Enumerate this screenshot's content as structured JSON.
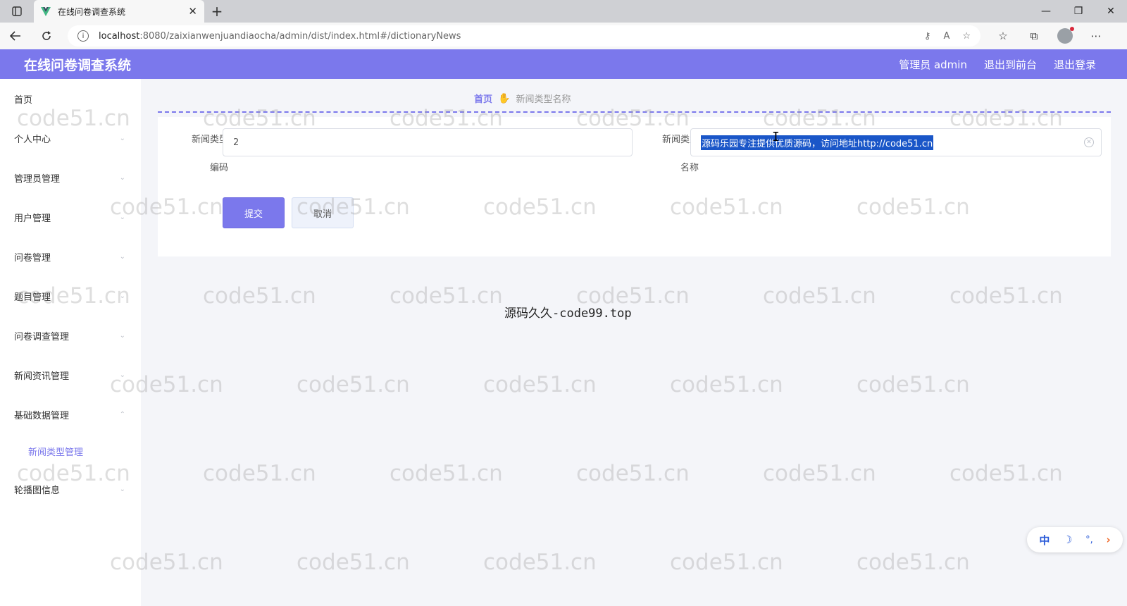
{
  "browser": {
    "tab_title": "在线问卷调查系统",
    "url_host": "localhost",
    "url_path": ":8080/zaixianwenjuandiaocha/admin/dist/index.html#/dictionaryNews"
  },
  "header": {
    "title": "在线问卷调查系统",
    "admin_label": "管理员 admin",
    "to_front_label": "退出到前台",
    "logout_label": "退出登录",
    "accent": "#7b78ec"
  },
  "sidebar": {
    "items": [
      {
        "label": "首页"
      },
      {
        "label": "个人中心"
      },
      {
        "label": "管理员管理"
      },
      {
        "label": "用户管理"
      },
      {
        "label": "问卷管理"
      },
      {
        "label": "题目管理"
      },
      {
        "label": "问卷调查管理"
      },
      {
        "label": "新闻资讯管理"
      },
      {
        "label": "基础数据管理"
      },
      {
        "label": "轮播图信息"
      }
    ],
    "sub_item": "新闻类型管理"
  },
  "breadcrumb": {
    "home": "首页",
    "current": "新闻类型名称"
  },
  "form": {
    "code_label_line1": "新闻类型",
    "code_label_line2": "编码",
    "code_value": "2",
    "name_label_line1": "新闻类型",
    "name_label_line2": "名称",
    "name_value": "源码乐园专注提供优质源码，访问地址http://code51.cn",
    "submit_label": "提交",
    "cancel_label": "取消"
  },
  "center_note": "源码久久-code99.top",
  "watermark": "code51.cn",
  "ime": {
    "mode": "中",
    "punct": "°,"
  }
}
